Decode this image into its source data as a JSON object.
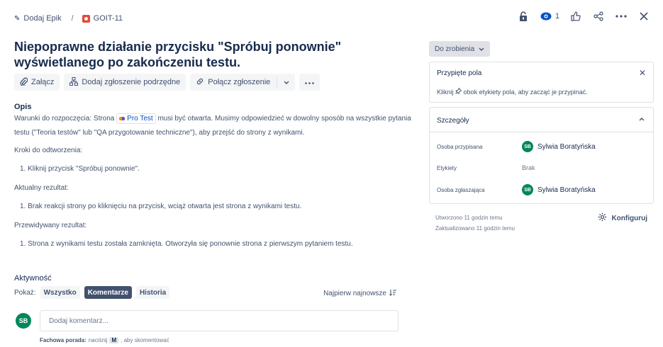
{
  "breadcrumb": {
    "epic_label": "Dodaj Epik",
    "separator": "/",
    "issue_key": "GOIT-11"
  },
  "top_actions": {
    "watch_count": "1",
    "icons": [
      "lock-icon",
      "eye-icon",
      "thumbs-up-icon",
      "share-icon",
      "more-icon",
      "close-icon"
    ]
  },
  "issue": {
    "title": "Niepoprawne działanie przycisku \"Spróbuj ponownie\" wyświetlanego po zakończeniu testu."
  },
  "toolbar": {
    "attach": "Załącz",
    "add_child": "Dodaj zgłoszenie podrzędne",
    "link_issue": "Połącz zgłoszenie"
  },
  "description": {
    "heading": "Opis",
    "pre_text": "Warunki do rozpoczęcia: Strona",
    "chip_label": "Pro Test",
    "post_text": "musi być otwarta. Musimy odpowiedzieć w dowolny sposób na wszystkie pytania testu  (\"Teoria testów\" lub \"QA przygotowanie techniczne\"), aby przejść do strony z wynikami.",
    "steps_heading": "Kroki do odtworzenia:",
    "step_1": "1. Kliknij przycisk \"Spróbuj ponownie\".",
    "actual_heading": "Aktualny rezultat:",
    "actual_1": "1. Brak reakcji strony po kliknięciu na przycisk, wciąż otwarta jest strona z wynikami testu.",
    "expected_heading": "Przewidywany rezultat:",
    "expected_1": "1. Strona z wynikami testu została zamknięta. Otworzyła się ponownie strona z pierwszym pytaniem testu."
  },
  "activity": {
    "heading": "Aktywność",
    "show_label": "Pokaż:",
    "filter_all": "Wszystko",
    "filter_comments": "Komentarze",
    "filter_history": "Historia",
    "sort_label": "Najpierw najnowsze",
    "user_initials": "SB",
    "comment_placeholder": "Dodaj komentarz...",
    "tip_bold": "Fachowa porada:",
    "tip_pre": "naciśnij",
    "tip_key": "M",
    "tip_post": ", aby skomentować"
  },
  "sidebar": {
    "status": "Do zrobienia",
    "pinned_title": "Przypięte pola",
    "pinned_pre": "Kliknij",
    "pinned_post": "obok etykiety pola, aby zacząć je przypinać.",
    "details_title": "Szczegóły",
    "assignee_label": "Osoba przypisana",
    "assignee_initials": "SB",
    "assignee_name": "Sylwia Boratyńska",
    "labels_label": "Etykiety",
    "labels_value": "Brak",
    "reporter_label": "Osoba zgłaszająca",
    "reporter_initials": "SB",
    "reporter_name": "Sylwia Boratyńska",
    "created": "Utworzono 11 godzin temu",
    "updated": "Zaktualizowano 11 godzin temu",
    "configure": "Konfiguruj"
  }
}
